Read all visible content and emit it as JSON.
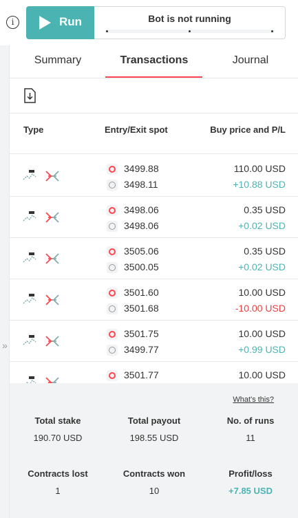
{
  "toolbar": {
    "run_label": "Run",
    "status_text": "Bot is not running",
    "info_icon": "info-icon",
    "play_icon": "play-icon"
  },
  "tabs": [
    {
      "label": "Summary",
      "active": false
    },
    {
      "label": "Transactions",
      "active": true
    },
    {
      "label": "Journal",
      "active": false
    }
  ],
  "columns": {
    "type": "Type",
    "entry_exit": "Entry/Exit spot",
    "buy_pl": "Buy price and P/L"
  },
  "transactions": [
    {
      "entry": "3499.88",
      "exit": "3498.11",
      "buy_price": "110.00 USD",
      "pl": "+10.88 USD",
      "pl_status": "profit"
    },
    {
      "entry": "3498.06",
      "exit": "3498.06",
      "buy_price": "0.35 USD",
      "pl": "+0.02 USD",
      "pl_status": "profit"
    },
    {
      "entry": "3505.06",
      "exit": "3500.05",
      "buy_price": "0.35 USD",
      "pl": "+0.02 USD",
      "pl_status": "profit"
    },
    {
      "entry": "3501.60",
      "exit": "3501.68",
      "buy_price": "10.00 USD",
      "pl": "-10.00 USD",
      "pl_status": "loss"
    },
    {
      "entry": "3501.75",
      "exit": "3499.77",
      "buy_price": "10.00 USD",
      "pl": "+0.99 USD",
      "pl_status": "profit"
    },
    {
      "entry": "3501.77",
      "exit": "",
      "buy_price": "10.00 USD",
      "pl": "",
      "pl_status": "profit"
    }
  ],
  "summary": {
    "whats_this": "What's this?",
    "total_stake_label": "Total stake",
    "total_stake": "190.70 USD",
    "total_payout_label": "Total payout",
    "total_payout": "198.55 USD",
    "runs_label": "No. of runs",
    "runs": "11",
    "lost_label": "Contracts lost",
    "lost": "1",
    "won_label": "Contracts won",
    "won": "10",
    "profit_label": "Profit/loss",
    "profit": "+7.85 USD"
  },
  "colors": {
    "accent": "#4bb4b3",
    "tab_active": "#ff444f",
    "loss": "#ec3f3f",
    "profit": "#4bb4b3"
  }
}
